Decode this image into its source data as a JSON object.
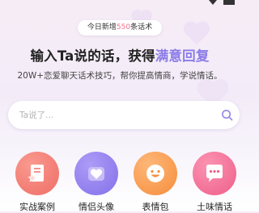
{
  "banner": {
    "badge_prefix": "今日新增",
    "badge_count": "550",
    "badge_suffix": "条话术",
    "headline_main": "输入Ta说的话，获得",
    "headline_accent": "满意回复",
    "subline": "20W+恋爱聊天话术技巧，帮你提高情商，学说情话。"
  },
  "search": {
    "placeholder": "Ta说了...",
    "value": ""
  },
  "categories": [
    {
      "label": "实战案例",
      "icon": "document-star-icon",
      "color": "#f27a72"
    },
    {
      "label": "情侣头像",
      "icon": "heart-icon",
      "color": "#8f7cef"
    },
    {
      "label": "表情包",
      "icon": "smiley-icon",
      "color": "#f89b50"
    },
    {
      "label": "土味情话",
      "icon": "chat-bubble-icon",
      "color": "#f26e94"
    }
  ],
  "colors": {
    "accent": "#8a7be8",
    "highlight": "#f06f8a"
  }
}
